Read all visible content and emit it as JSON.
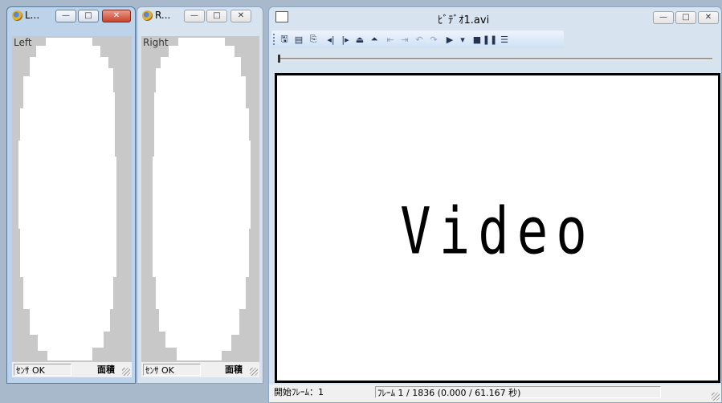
{
  "left_window": {
    "title": "L...",
    "canvas_label": "Left",
    "status_sensor": "ｾﾝｻ OK",
    "status_area": "面積"
  },
  "right_window": {
    "title": "R...",
    "canvas_label": "Right",
    "status_sensor": "ｾﾝｻ OK",
    "status_area": "面積"
  },
  "video_window": {
    "title": "ﾋﾞﾃﾞｵ1.avi",
    "video_text": "Video",
    "status_start_frame": "開始ﾌﾚｰﾑ：1",
    "status_frame_info": "ﾌﾚｰﾑ 1 / 1836  (0.000 / 61.167 秒)"
  },
  "glyphs": {
    "minimize": "—",
    "maximize": "□",
    "close_active": "✕",
    "close_inactive": "✕"
  },
  "toolbar_icons": [
    "save-icon",
    "save-as-icon",
    "copy-icon",
    "prev-frame-icon",
    "next-frame-icon",
    "mark-in-icon",
    "mark-out-icon",
    "set-start-icon",
    "set-end-icon",
    "undo-icon",
    "redo-icon",
    "play-icon",
    "play-dropdown-icon",
    "stop-icon",
    "pause-icon",
    "properties-icon"
  ],
  "toolbar_glyphs": [
    "🖫",
    "▤",
    "⎘",
    "◂|",
    "|▸",
    "⏏",
    "⏶",
    "⇤",
    "⇥",
    "↶",
    "↷",
    "▶",
    "▾",
    "■",
    "❚❚",
    "☰"
  ],
  "colors": {
    "sensor_background": "#c8c8c8",
    "frame_blue": "#a9b9cc"
  }
}
